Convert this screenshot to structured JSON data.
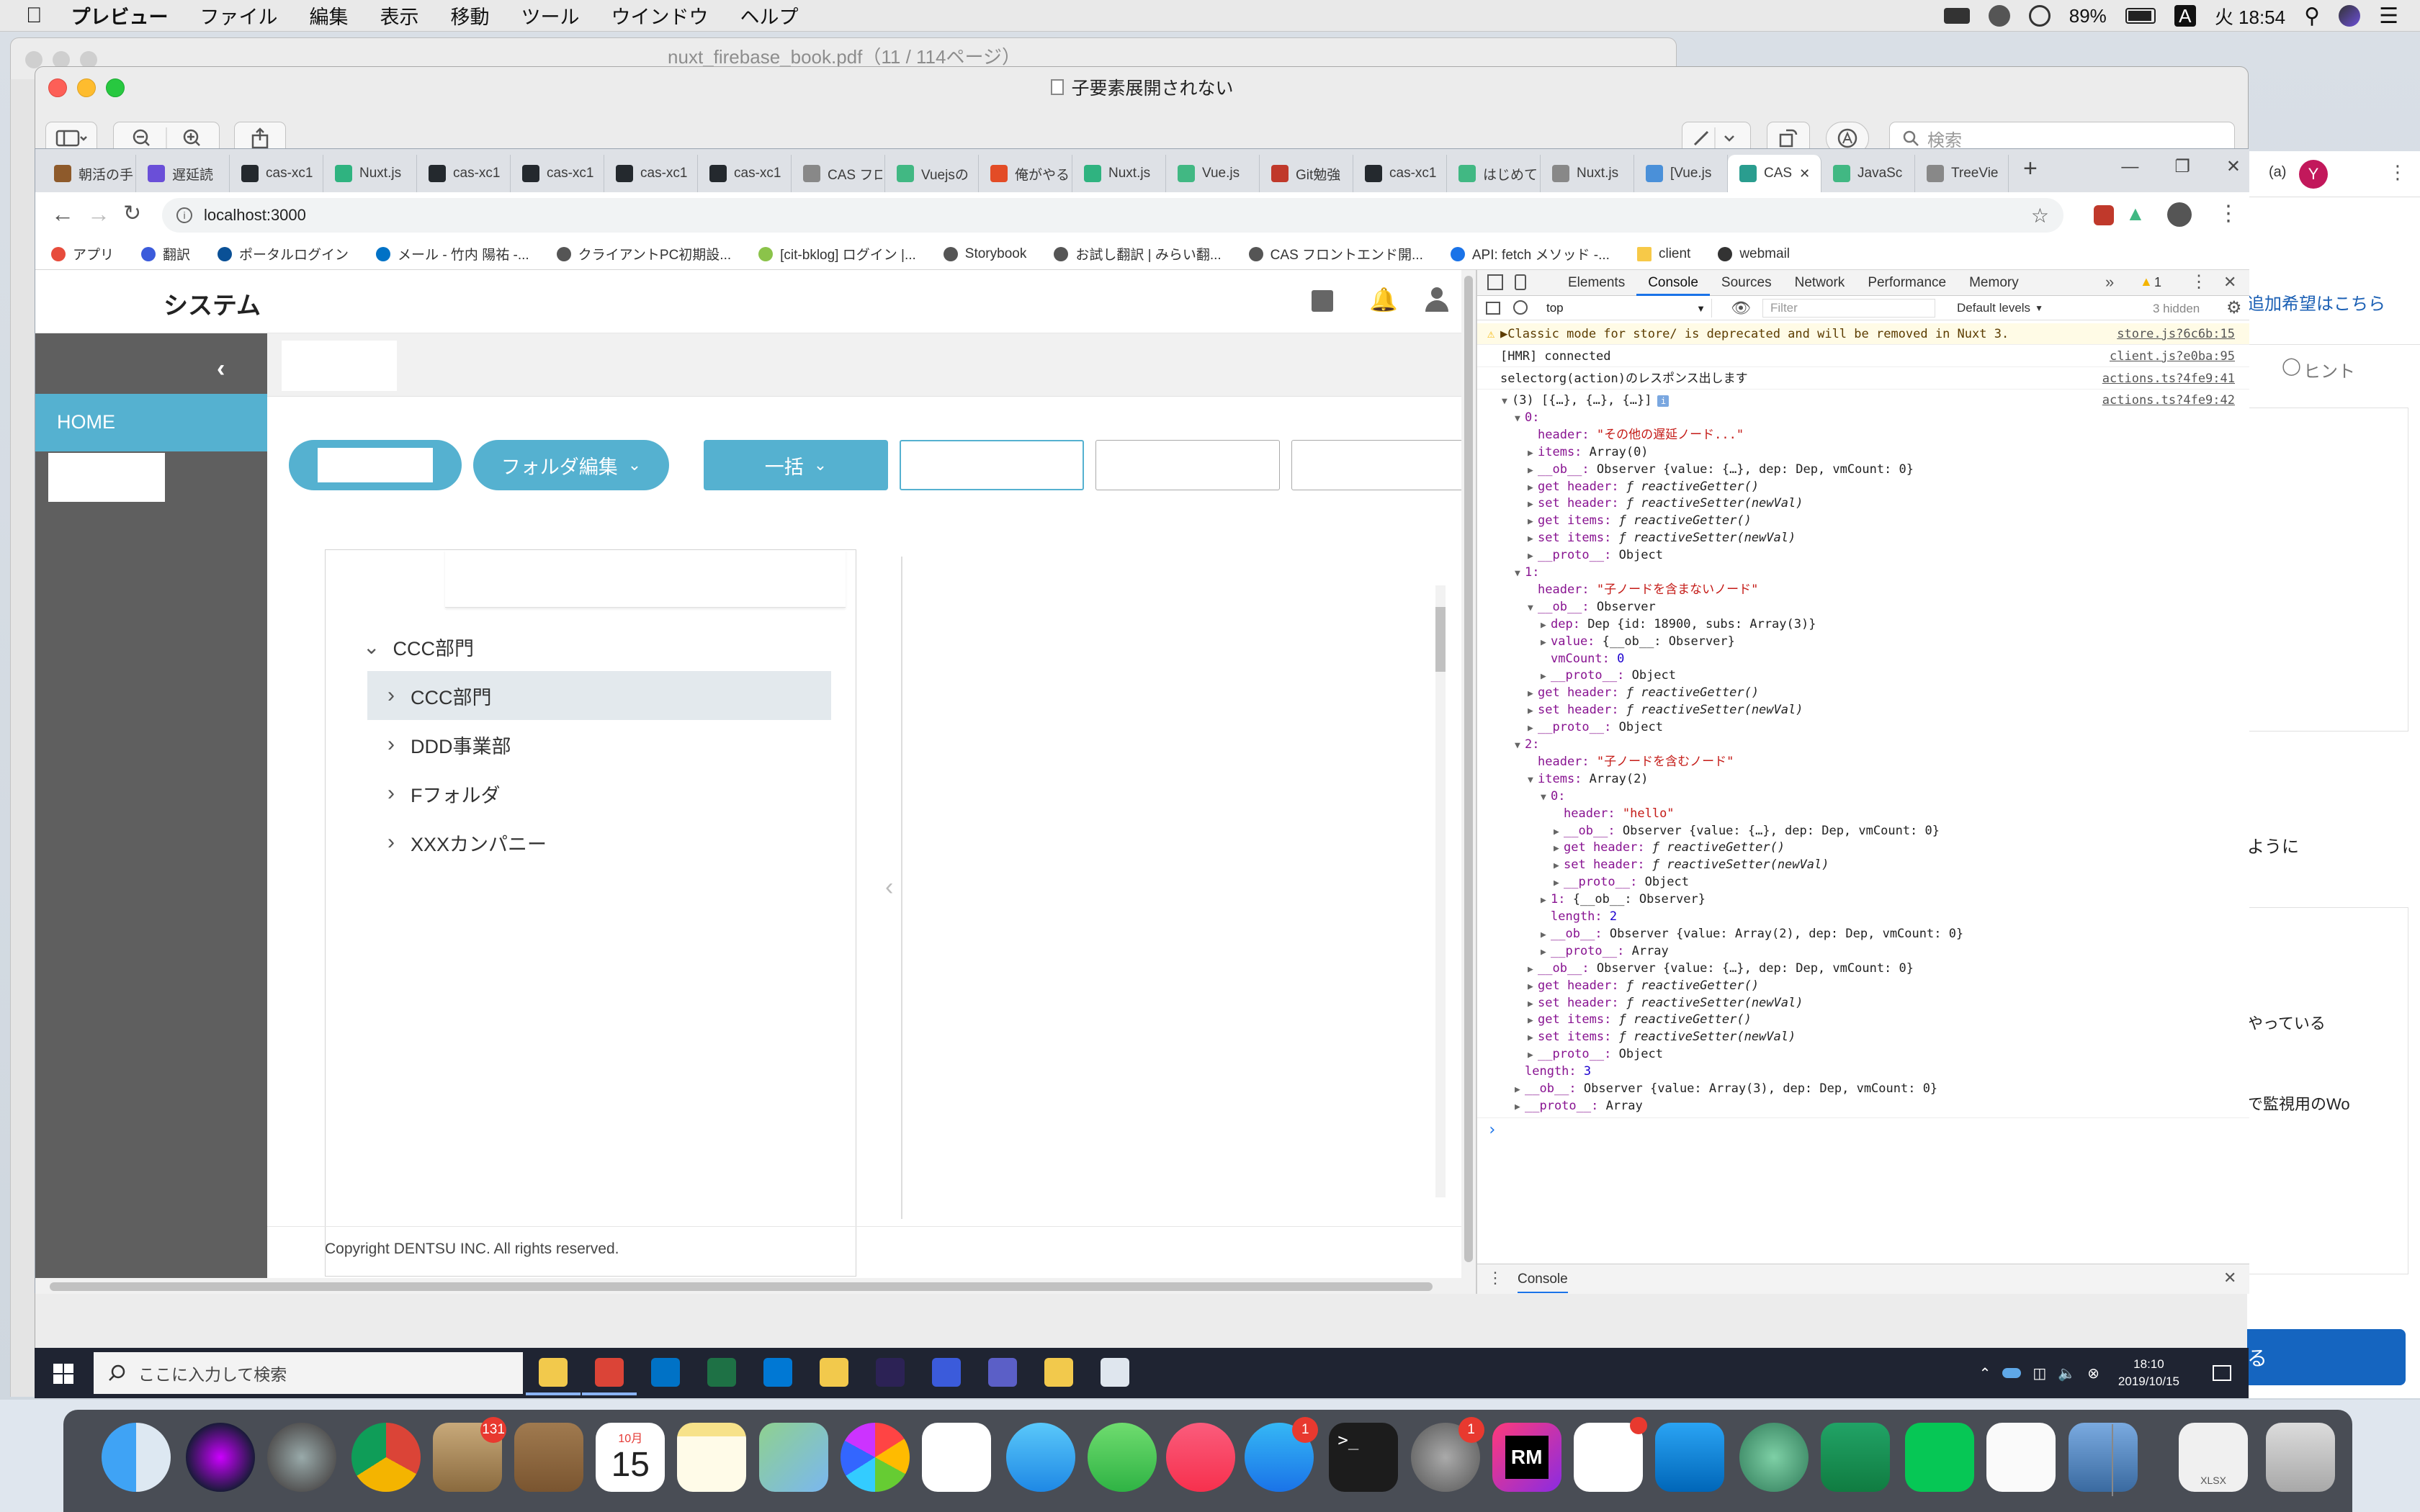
{
  "menubar": {
    "app": "プレビュー",
    "items": [
      "ファイル",
      "編集",
      "表示",
      "移動",
      "ツール",
      "ウインドウ",
      "ヘルプ"
    ],
    "battery": "89%",
    "input_mode": "A",
    "clock": "火 18:54"
  },
  "pdf_window": {
    "title": "nuxt_firebase_book.pdf（11 / 114ページ）"
  },
  "preview_window": {
    "title": "子要素展開されない",
    "search_placeholder": "検索",
    "avatar": "Y",
    "extra": "(a)"
  },
  "doc_right": {
    "lines": [
      "追加希望はこちら",
      "ヒント",
      "ように",
      "やっている",
      "で監視用のWo"
    ]
  },
  "browser": {
    "tabs": [
      "朝活の手",
      "遅延読",
      "cas-xc1",
      "Nuxt.js",
      "cas-xc1",
      "cas-xc1",
      "cas-xc1",
      "cas-xc1",
      "CAS フロ",
      "Vuejsの",
      "俺がやる",
      "Nuxt.js",
      "Vue.js",
      "Git勉強",
      "cas-xc1",
      "はじめて",
      "Nuxt.js",
      "[Vue.js",
      "CAS",
      "JavaSc",
      "TreeVie"
    ],
    "url": "localhost:3000",
    "bookmarks": [
      "アプリ",
      "翻訳",
      "ポータルログイン",
      "メール - 竹内 陽祐 -...",
      "クライアントPC初期設...",
      "[cit-bklog] ログイン |...",
      "Storybook",
      "お試し翻訳 | みらい翻...",
      "CAS フロントエンド開...",
      "API: fetch メソッド -...",
      "client",
      "webmail"
    ]
  },
  "app": {
    "title": "システム",
    "nav_home": "HOME",
    "folder_edit": "フォルダ編集",
    "bulk": "一括",
    "tree": [
      {
        "label": "CCC部門",
        "expanded": true
      },
      {
        "label": "CCC部門",
        "selected": true
      },
      {
        "label": "DDD事業部"
      },
      {
        "label": "Fフォルダ"
      },
      {
        "label": "XXXカンパニー"
      }
    ],
    "copyright": "Copyright DENTSU INC. All rights reserved."
  },
  "devtools": {
    "tabs": [
      "Elements",
      "Console",
      "Sources",
      "Network",
      "Performance",
      "Memory"
    ],
    "active_tab": "Console",
    "warn_count": "1",
    "context": "top",
    "filter_placeholder": "Filter",
    "levels": "Default levels",
    "hidden": "3 hidden",
    "drawer_tab": "Console",
    "messages": [
      {
        "text": "Classic mode for store/ is deprecated and will be removed in Nuxt 3.",
        "source": "store.js?6c6b:15",
        "level": "warn"
      },
      {
        "text": "[HMR] connected",
        "source": "client.js?e0ba:95"
      },
      {
        "text": "selectorg(action)のレスポンス出します",
        "source": "actions.ts?4fe9:41"
      }
    ],
    "object_source": "actions.ts?4fe9:42"
  },
  "console_tree": [
    {
      "i": 0,
      "t": "▼",
      "k": "(3) [{…}, {…}, {…}]",
      "info": true
    },
    {
      "i": 1,
      "t": "▼",
      "k": "0:"
    },
    {
      "i": 2,
      "k": "header",
      "v": "\"その他の遅延ノード...\"",
      "vt": "str"
    },
    {
      "i": 2,
      "t": "▶",
      "k": "items",
      "v": "Array(0)"
    },
    {
      "i": 2,
      "t": "▶",
      "k": "__ob__",
      "v": "Observer {value: {…}, dep: Dep, vmCount: 0}"
    },
    {
      "i": 2,
      "t": "▶",
      "k": "get header",
      "v": "ƒ reactiveGetter()",
      "vt": "fn"
    },
    {
      "i": 2,
      "t": "▶",
      "k": "set header",
      "v": "ƒ reactiveSetter(newVal)",
      "vt": "fn"
    },
    {
      "i": 2,
      "t": "▶",
      "k": "get items",
      "v": "ƒ reactiveGetter()",
      "vt": "fn"
    },
    {
      "i": 2,
      "t": "▶",
      "k": "set items",
      "v": "ƒ reactiveSetter(newVal)",
      "vt": "fn"
    },
    {
      "i": 2,
      "t": "▶",
      "k": "__proto__",
      "v": "Object"
    },
    {
      "i": 1,
      "t": "▼",
      "k": "1:"
    },
    {
      "i": 2,
      "k": "header",
      "v": "\"子ノードを含まないノード\"",
      "vt": "str"
    },
    {
      "i": 2,
      "t": "▼",
      "k": "__ob__",
      "v": "Observer"
    },
    {
      "i": 3,
      "t": "▶",
      "k": "dep",
      "v": "Dep {id: 18900, subs: Array(3)}"
    },
    {
      "i": 3,
      "t": "▶",
      "k": "value",
      "v": "{__ob__: Observer}"
    },
    {
      "i": 3,
      "k": "vmCount",
      "v": "0",
      "vt": "num"
    },
    {
      "i": 3,
      "t": "▶",
      "k": "__proto__",
      "v": "Object"
    },
    {
      "i": 2,
      "t": "▶",
      "k": "get header",
      "v": "ƒ reactiveGetter()",
      "vt": "fn"
    },
    {
      "i": 2,
      "t": "▶",
      "k": "set header",
      "v": "ƒ reactiveSetter(newVal)",
      "vt": "fn"
    },
    {
      "i": 2,
      "t": "▶",
      "k": "__proto__",
      "v": "Object"
    },
    {
      "i": 1,
      "t": "▼",
      "k": "2:"
    },
    {
      "i": 2,
      "k": "header",
      "v": "\"子ノードを含むノード\"",
      "vt": "str"
    },
    {
      "i": 2,
      "t": "▼",
      "k": "items",
      "v": "Array(2)"
    },
    {
      "i": 3,
      "t": "▼",
      "k": "0:"
    },
    {
      "i": 4,
      "k": "header",
      "v": "\"hello\"",
      "vt": "str"
    },
    {
      "i": 4,
      "t": "▶",
      "k": "__ob__",
      "v": "Observer {value: {…}, dep: Dep, vmCount: 0}"
    },
    {
      "i": 4,
      "t": "▶",
      "k": "get header",
      "v": "ƒ reactiveGetter()",
      "vt": "fn"
    },
    {
      "i": 4,
      "t": "▶",
      "k": "set header",
      "v": "ƒ reactiveSetter(newVal)",
      "vt": "fn"
    },
    {
      "i": 4,
      "t": "▶",
      "k": "__proto__",
      "v": "Object"
    },
    {
      "i": 3,
      "t": "▶",
      "k": "1",
      "v": "{__ob__: Observer}"
    },
    {
      "i": 3,
      "k": "length",
      "v": "2",
      "vt": "num"
    },
    {
      "i": 3,
      "t": "▶",
      "k": "__ob__",
      "v": "Observer {value: Array(2), dep: Dep, vmCount: 0}"
    },
    {
      "i": 3,
      "t": "▶",
      "k": "__proto__",
      "v": "Array"
    },
    {
      "i": 2,
      "t": "▶",
      "k": "__ob__",
      "v": "Observer {value: {…}, dep: Dep, vmCount: 0}"
    },
    {
      "i": 2,
      "t": "▶",
      "k": "get header",
      "v": "ƒ reactiveGetter()",
      "vt": "fn"
    },
    {
      "i": 2,
      "t": "▶",
      "k": "set header",
      "v": "ƒ reactiveSetter(newVal)",
      "vt": "fn"
    },
    {
      "i": 2,
      "t": "▶",
      "k": "get items",
      "v": "ƒ reactiveGetter()",
      "vt": "fn"
    },
    {
      "i": 2,
      "t": "▶",
      "k": "set items",
      "v": "ƒ reactiveSetter(newVal)",
      "vt": "fn"
    },
    {
      "i": 2,
      "t": "▶",
      "k": "__proto__",
      "v": "Object"
    },
    {
      "i": 1,
      "k": "length",
      "v": "3",
      "vt": "num"
    },
    {
      "i": 1,
      "t": "▶",
      "k": "__ob__",
      "v": "Observer {value: Array(3), dep: Dep, vmCount: 0}"
    },
    {
      "i": 1,
      "t": "▶",
      "k": "__proto__",
      "v": "Array"
    }
  ],
  "taskbar": {
    "search": "ここに入力して検索",
    "time": "18:10",
    "date": "2019/10/15"
  },
  "dock": {
    "mail_badge": "131",
    "calendar_month": "10月",
    "calendar_day": "15",
    "appstore_badge": "1",
    "settings_badge": "1",
    "rm_label": "RM",
    "xlsx_label": "XLSX"
  }
}
